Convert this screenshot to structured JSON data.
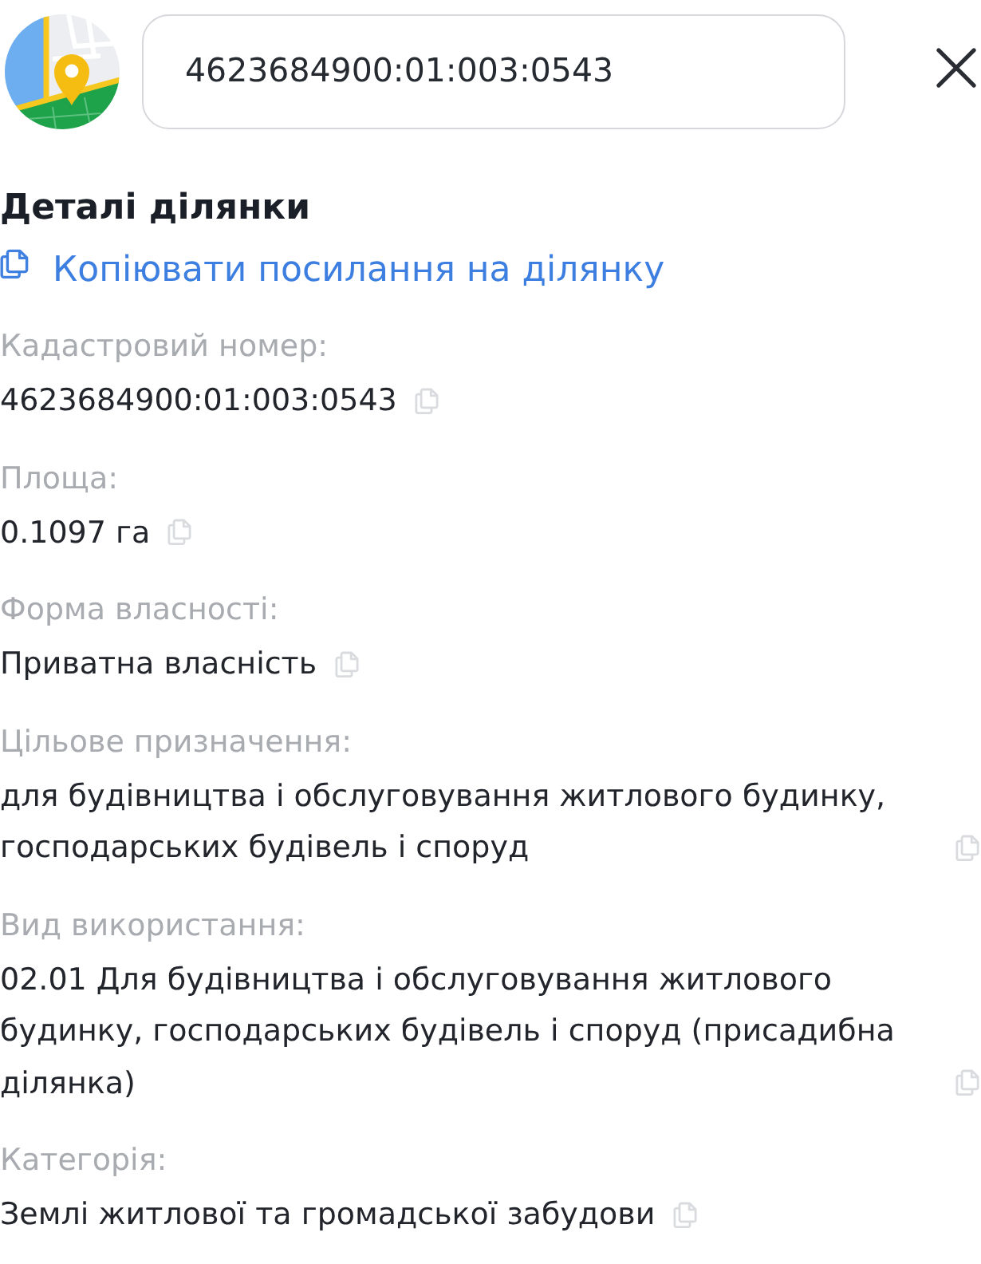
{
  "header": {
    "search": {
      "value": "4623684900:01:003:0543"
    }
  },
  "details": {
    "title": "Деталі ділянки",
    "copy_link": "Копіювати посилання на ділянку",
    "fields": [
      {
        "label": "Кадастровий номер:",
        "value": "4623684900:01:003:0543"
      },
      {
        "label": "Площа:",
        "value": "0.1097 га"
      },
      {
        "label": "Форма власності:",
        "value": "Приватна власність"
      },
      {
        "label": "Цільове призначення:",
        "value": "для будівництва і обслуговування житлового будинку, господарських будівель і споруд"
      },
      {
        "label": "Вид використання:",
        "value": "02.01 Для будівництва і обслуговування житлового будинку, господарських будівель і споруд (присадибна ділянка)"
      },
      {
        "label": "Категорія:",
        "value": "Землі житлової та громадської забудови"
      }
    ]
  }
}
